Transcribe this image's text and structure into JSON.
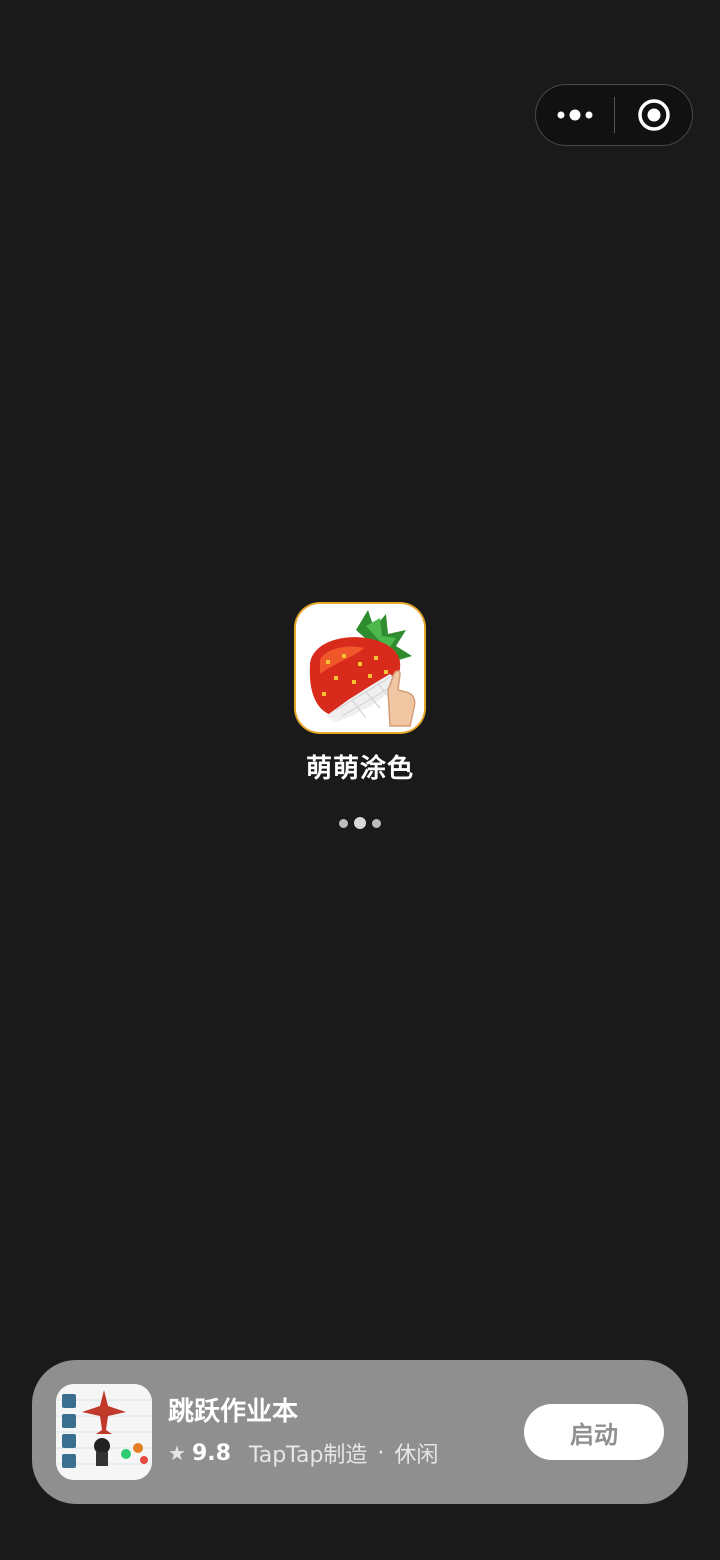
{
  "capsule": {
    "more_icon": "more-dots-icon",
    "close_icon": "target-close-icon"
  },
  "app": {
    "name": "萌萌涂色",
    "icon": "strawberry-pixel-icon",
    "loading_icon": "loading-dots-icon"
  },
  "promo": {
    "icon": "jumping-homework-game-icon",
    "title": "跳跃作业本",
    "star_icon": "star-icon",
    "rating": "9.8",
    "maker": "TapTap制造",
    "separator": "·",
    "category": "休闲",
    "button_label": "启动"
  },
  "colors": {
    "background": "#1a1a1a",
    "promo_card": "#8f8f8f",
    "icon_border": "#e6a629"
  }
}
